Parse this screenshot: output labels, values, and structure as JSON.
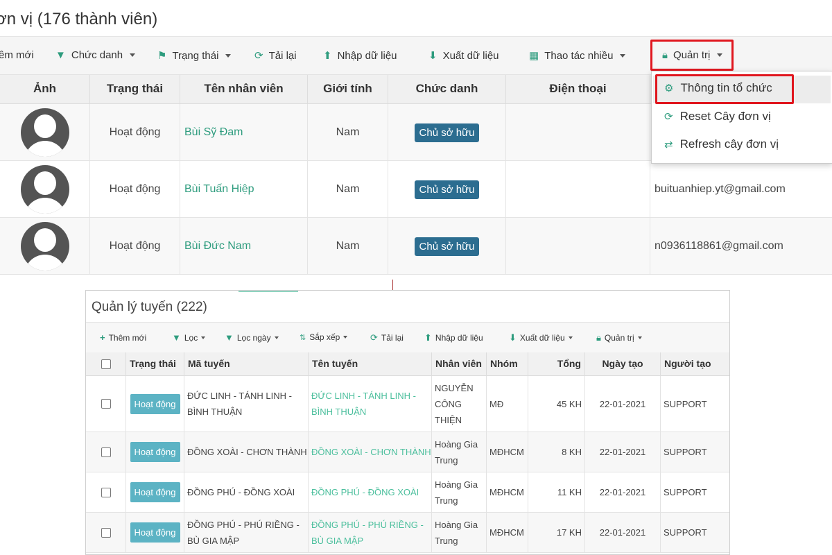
{
  "top": {
    "title": "ơn vị (176 thành viên)",
    "toolbar": {
      "add": "êm mới",
      "position": "Chức danh",
      "status": "Trạng thái",
      "reload": "Tải lại",
      "import": "Nhập dữ liệu",
      "export": "Xuất dữ liệu",
      "bulk": "Thao tác nhiều",
      "admin": "Quản trị"
    },
    "headers": [
      "Ảnh",
      "Trạng thái",
      "Tên nhân viên",
      "Giới tính",
      "Chức danh",
      "Điện thoại"
    ],
    "rows": [
      {
        "status": "Hoạt động",
        "name": "Bùi Sỹ Đam",
        "gender": "Nam",
        "role": "Chủ sở hữu",
        "email": ""
      },
      {
        "status": "Hoạt động",
        "name": "Bùi Tuấn Hiệp",
        "gender": "Nam",
        "role": "Chủ sở hữu",
        "email": "buituanhiep.yt@gmail.com"
      },
      {
        "status": "Hoạt động",
        "name": "Bùi Đức Nam",
        "gender": "Nam",
        "role": "Chủ sở hữu",
        "email": "n0936118861@gmail.com"
      }
    ],
    "admin_menu": {
      "org_info": "Thông tin tổ chức",
      "reset_tree": "Reset Cây đơn vị",
      "refresh_tree": "Refresh cây đơn vị"
    }
  },
  "bottom": {
    "title": "Quản lý tuyến (222)",
    "toolbar": {
      "add": "Thêm mới",
      "filter": "Lọc",
      "filter_date": "Lọc ngày",
      "sort": "Sắp xếp",
      "reload": "Tải lại",
      "import": "Nhập dữ liệu",
      "export": "Xuất dữ liệu",
      "admin": "Quản trị"
    },
    "headers": {
      "status": "Trạng thái",
      "code": "Mã tuyến",
      "name": "Tên tuyến",
      "staff": "Nhân viên",
      "group": "Nhóm",
      "total": "Tổng",
      "created": "Ngày tạo",
      "creator": "Người tạo"
    },
    "rows": [
      {
        "status": "Hoạt động",
        "code": "ĐỨC LINH - TÁNH LINH - BÌNH THUẬN",
        "name": "ĐỨC LINH - TÁNH LINH - BÌNH THUẬN",
        "staff": "NGUYỄN CÔNG THIỆN",
        "group": "MĐ",
        "total": "45 KH",
        "created": "22-01-2021",
        "creator": "SUPPORT"
      },
      {
        "status": "Hoạt động",
        "code": "ĐỒNG XOÀI - CHƠN THÀNH",
        "name": "ĐỒNG XOÀI - CHƠN THÀNH",
        "staff": "Hoàng Gia Trung",
        "group": "MĐHCM",
        "total": "8 KH",
        "created": "22-01-2021",
        "creator": "SUPPORT"
      },
      {
        "status": "Hoạt động",
        "code": "ĐỒNG PHÚ - ĐỒNG XOÀI",
        "name": "ĐỒNG PHÚ - ĐỒNG XOÀI",
        "staff": "Hoàng Gia Trung",
        "group": "MĐHCM",
        "total": "11 KH",
        "created": "22-01-2021",
        "creator": "SUPPORT"
      },
      {
        "status": "Hoạt động",
        "code": "ĐỒNG PHÚ - PHÚ RIỀNG - BÙ GIA MẬP",
        "name": "ĐỒNG PHÚ - PHÚ RIỀNG - BÙ GIA MẬP",
        "staff": "Hoàng Gia Trung",
        "group": "MĐHCM",
        "total": "17 KH",
        "created": "22-01-2021",
        "creator": "SUPPORT"
      }
    ]
  },
  "colors": {
    "accent_green": "#2e9c7e",
    "badge_blue": "#2c6d90",
    "status_teal": "#5cb3c4",
    "highlight_red": "#e0161e"
  }
}
